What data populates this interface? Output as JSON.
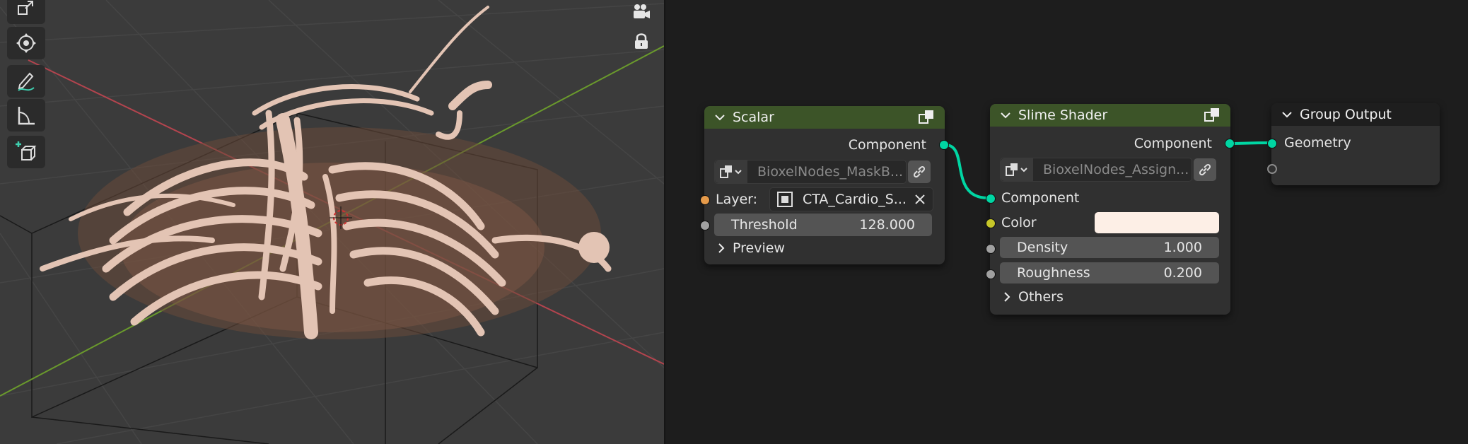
{
  "colors": {
    "viewport_bg": "#3b3b3b",
    "editor_bg": "#1d1d1d",
    "node_bg": "#303030",
    "header_green": "#3c5428",
    "header_dark": "#1e1e1e",
    "socket_geometry": "#00d6a3",
    "socket_layer": "#e59a4a",
    "socket_float": "#a1a1a1",
    "socket_color": "#c7c729",
    "axis_x": "#b3444e",
    "axis_y": "#6a9a2c",
    "bones": "#e3c4b4",
    "color_swatch": "#fdefe6"
  },
  "viewport": {
    "tools": [
      "scale-icon",
      "transform-icon",
      "annotate-icon",
      "measure-icon",
      "add-cube-icon"
    ],
    "nav_icons": [
      "camera-icon",
      "lock-icon"
    ]
  },
  "nodes": {
    "scalar": {
      "title": "Scalar",
      "output_label": "Component",
      "datablock": "BioxelNodes_MaskB...",
      "layer_label": "Layer:",
      "layer_value": "CTA_Cardio_S...",
      "threshold_label": "Threshold",
      "threshold_value": "128.000",
      "preview_label": "Preview"
    },
    "slime": {
      "title": "Slime Shader",
      "output_label": "Component",
      "datablock": "BioxelNodes_Assign...",
      "input_component": "Component",
      "color_label": "Color",
      "density_label": "Density",
      "density_value": "1.000",
      "roughness_label": "Roughness",
      "roughness_value": "0.200",
      "others_label": "Others"
    },
    "output": {
      "title": "Group Output",
      "geometry_label": "Geometry"
    }
  }
}
